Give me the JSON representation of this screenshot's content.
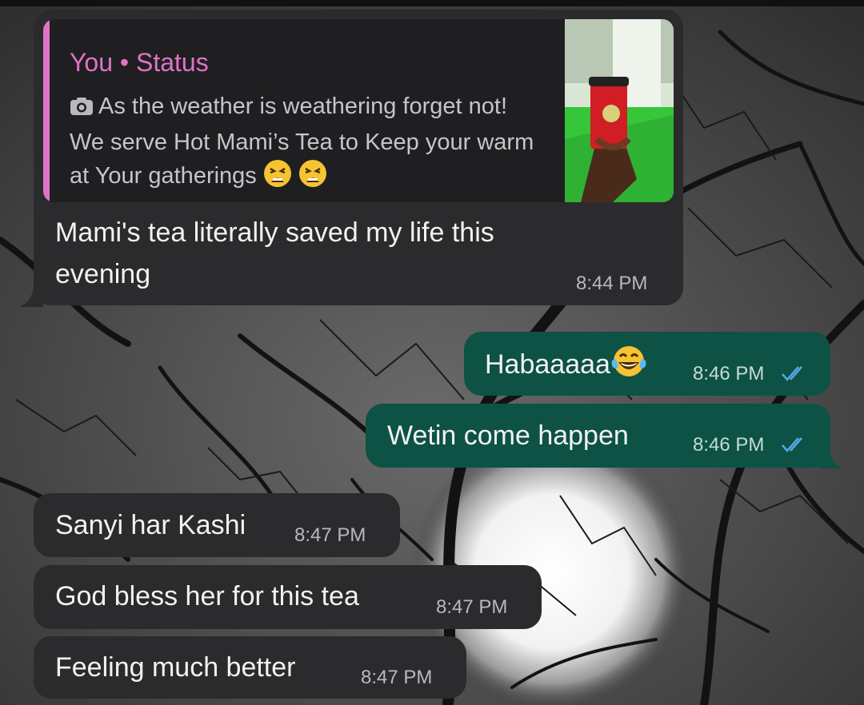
{
  "status_reply": {
    "header": "You • Status",
    "caption": "As the weather is weathering forget not! We serve Hot Mami’s Tea to Keep your warm at Your gatherings",
    "thumbnail_icon": "tea-cup-photo"
  },
  "messages": [
    {
      "direction": "incoming",
      "text_line1": "Mami's tea literally saved my life this",
      "text_line2": "evening",
      "time": "8:44 PM"
    },
    {
      "direction": "outgoing",
      "text": "Habaaaaa",
      "emoji": "tears-of-joy-emoji",
      "time": "8:46 PM",
      "status": "read-ticks"
    },
    {
      "direction": "outgoing",
      "text": "Wetin come happen",
      "time": "8:46 PM",
      "status": "read-ticks"
    },
    {
      "direction": "incoming",
      "text": "Sanyi har Kashi",
      "time": "8:47 PM"
    },
    {
      "direction": "incoming",
      "text": "God bless her for this tea",
      "time": "8:47 PM"
    },
    {
      "direction": "incoming",
      "text": "Feeling much better",
      "time": "8:47 PM"
    }
  ],
  "colors": {
    "incoming_bubble": "#2b2b2e",
    "outgoing_bubble": "#0d5244",
    "reply_accent": "#e073c6",
    "read_ticks": "#53a6e8"
  }
}
